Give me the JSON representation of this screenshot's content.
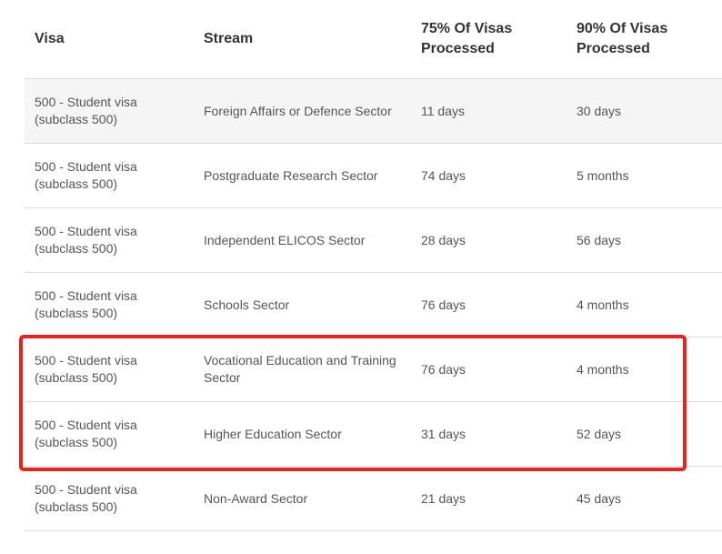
{
  "table": {
    "headers": [
      "Visa",
      "Stream",
      "75% Of Visas Processed",
      "90% Of Visas Processed"
    ],
    "rows": [
      {
        "visa": "500 - Student visa (subclass 500)",
        "stream": "Foreign Affairs or Defence Sector",
        "p75": "11 days",
        "p90": "30 days"
      },
      {
        "visa": "500 - Student visa (subclass 500)",
        "stream": "Postgraduate Research Sector",
        "p75": "74 days",
        "p90": "5 months"
      },
      {
        "visa": "500 - Student visa (subclass 500)",
        "stream": "Independent ELICOS Sector",
        "p75": "28 days",
        "p90": "56 days"
      },
      {
        "visa": "500 - Student visa (subclass 500)",
        "stream": "Schools Sector",
        "p75": "76 days",
        "p90": "4 months"
      },
      {
        "visa": "500 - Student visa (subclass 500)",
        "stream": "Vocational Education and Training Sector",
        "p75": "76 days",
        "p90": "4 months"
      },
      {
        "visa": "500 - Student visa (subclass 500)",
        "stream": "Higher Education Sector",
        "p75": "31 days",
        "p90": "52 days"
      },
      {
        "visa": "500 - Student visa (subclass 500)",
        "stream": "Non-Award Sector",
        "p75": "21 days",
        "p90": "45 days"
      }
    ]
  },
  "highlight": {
    "color": "#e8231e",
    "rows_highlighted": [
      5,
      6
    ]
  }
}
